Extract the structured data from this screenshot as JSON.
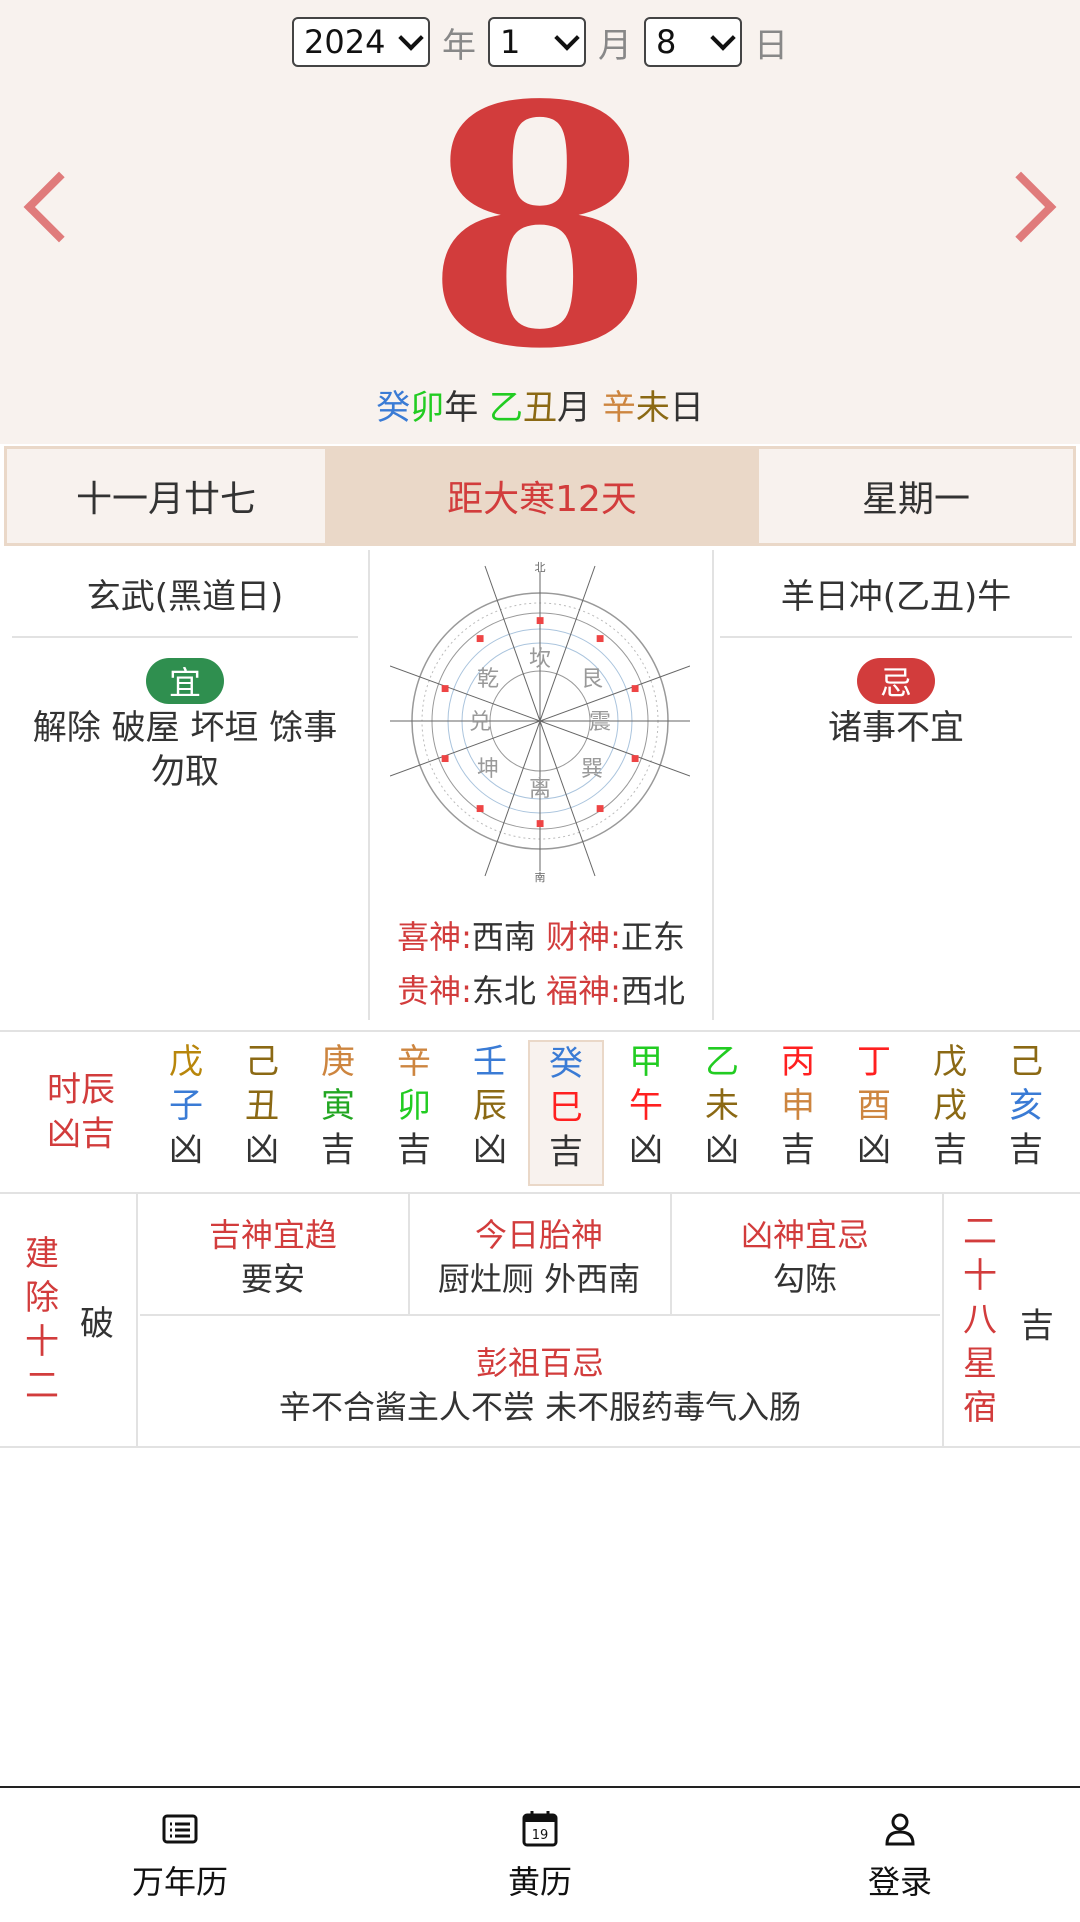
{
  "date_select": {
    "year": "2024",
    "year_unit": "年",
    "month": "1",
    "month_unit": "月",
    "day": "8",
    "day_unit": "日"
  },
  "big_day": "8",
  "ganzhi": {
    "year_stem": "癸",
    "year_branch": "卯",
    "year_unit": "年",
    "month_stem": "乙",
    "month_branch": "丑",
    "month_unit": "月",
    "day_stem": "辛",
    "day_branch": "未",
    "day_unit": "日"
  },
  "info_bar": {
    "lunar_date": "十一月廿七",
    "jieqi": "距大寒12天",
    "weekday": "星期一"
  },
  "left_panel": {
    "title": "玄武(黑道日)",
    "badge": "宜",
    "acts_line1": "解除 破屋 坏垣 馀事",
    "acts_line2": "勿取"
  },
  "right_panel": {
    "title": "羊日冲(乙丑)牛",
    "badge": "忌",
    "acts": "诸事不宜"
  },
  "gods": {
    "xishen_label": "喜神:",
    "xishen": "西南",
    "caishen_label": "财神:",
    "caishen": "正东",
    "guishen_label": "贵神:",
    "guishen": "东北",
    "fushen_label": "福神:",
    "fushen": "西北"
  },
  "hours": {
    "label_line1": "时辰",
    "label_line2": "凶吉",
    "items": [
      {
        "stem": "戊",
        "branch": "子",
        "luck": "凶",
        "stem_color": "#b8860b",
        "branch_color": "#3a7bd5"
      },
      {
        "stem": "己",
        "branch": "丑",
        "luck": "凶",
        "stem_color": "#8b6914",
        "branch_color": "#8b6914"
      },
      {
        "stem": "庚",
        "branch": "寅",
        "luck": "吉",
        "stem_color": "#cd853f",
        "branch_color": "#22a622"
      },
      {
        "stem": "辛",
        "branch": "卯",
        "luck": "吉",
        "stem_color": "#cd853f",
        "branch_color": "#22cc22"
      },
      {
        "stem": "壬",
        "branch": "辰",
        "luck": "凶",
        "stem_color": "#3a7bd5",
        "branch_color": "#8b6914"
      },
      {
        "stem": "癸",
        "branch": "巳",
        "luck": "吉",
        "stem_color": "#3a7bd5",
        "branch_color": "#ff2020"
      },
      {
        "stem": "甲",
        "branch": "午",
        "luck": "凶",
        "stem_color": "#22cc22",
        "branch_color": "#ff2020"
      },
      {
        "stem": "乙",
        "branch": "未",
        "luck": "凶",
        "stem_color": "#22cc22",
        "branch_color": "#8b6914"
      },
      {
        "stem": "丙",
        "branch": "申",
        "luck": "吉",
        "stem_color": "#ff2020",
        "branch_color": "#cd853f"
      },
      {
        "stem": "丁",
        "branch": "酉",
        "luck": "凶",
        "stem_color": "#ff2020",
        "branch_color": "#cd853f"
      },
      {
        "stem": "戊",
        "branch": "戌",
        "luck": "吉",
        "stem_color": "#8b6914",
        "branch_color": "#8b6914"
      },
      {
        "stem": "己",
        "branch": "亥",
        "luck": "吉",
        "stem_color": "#8b6914",
        "branch_color": "#3a7bd5"
      }
    ],
    "active_index": 5
  },
  "jianchu": {
    "label": "建除十二",
    "value": "破"
  },
  "cells": {
    "jishen_title": "吉神宜趋",
    "jishen": "要安",
    "taishen_title": "今日胎神",
    "taishen": "厨灶厕 外西南",
    "xiongshen_title": "凶神宜忌",
    "xiongshen": "勾陈",
    "pengzu_title": "彭祖百忌",
    "pengzu": "辛不合酱主人不尝 未不服药毒气入肠"
  },
  "xingsu": {
    "label": "二十八星宿",
    "value": "吉"
  },
  "tabbar": [
    {
      "label": "万年历",
      "icon": "list-icon"
    },
    {
      "label": "黄历",
      "icon": "calendar-icon",
      "icon_text": "19"
    },
    {
      "label": "登录",
      "icon": "user-icon"
    }
  ],
  "colors": {
    "accent_red": "#d23c3c",
    "header_bg": "#f8f2ee",
    "tab_active_bg": "#ead8c8",
    "yi_green": "#2f8f4f"
  },
  "compass_labels": {
    "inner": [
      "坎",
      "艮",
      "震",
      "巽",
      "离",
      "坤",
      "兑",
      "乾"
    ],
    "top": "北",
    "bottom": "南"
  }
}
